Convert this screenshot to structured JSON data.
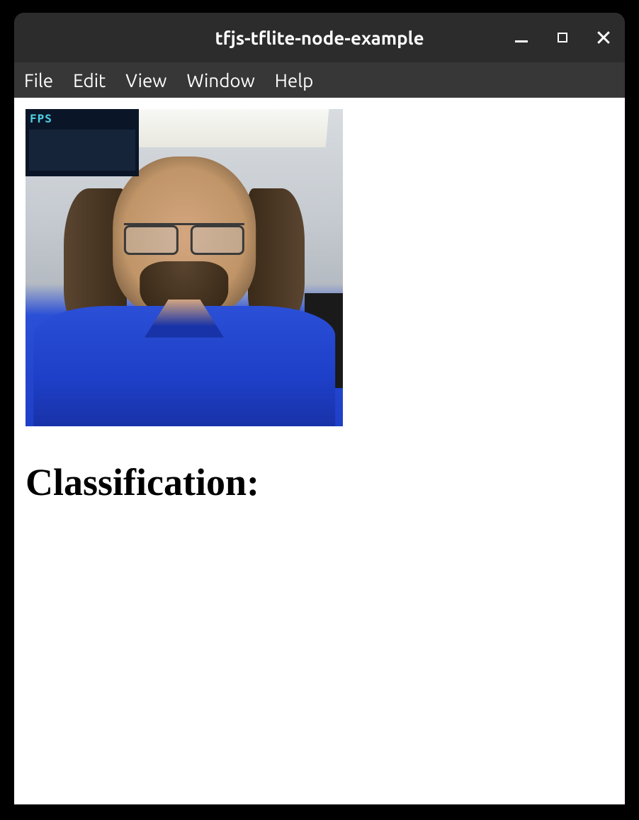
{
  "window": {
    "title": "tfjs-tflite-node-example"
  },
  "menubar": {
    "items": [
      {
        "label": "File"
      },
      {
        "label": "Edit"
      },
      {
        "label": "View"
      },
      {
        "label": "Window"
      },
      {
        "label": "Help"
      }
    ]
  },
  "fps": {
    "label": "FPS"
  },
  "content": {
    "heading": "Classification:"
  }
}
